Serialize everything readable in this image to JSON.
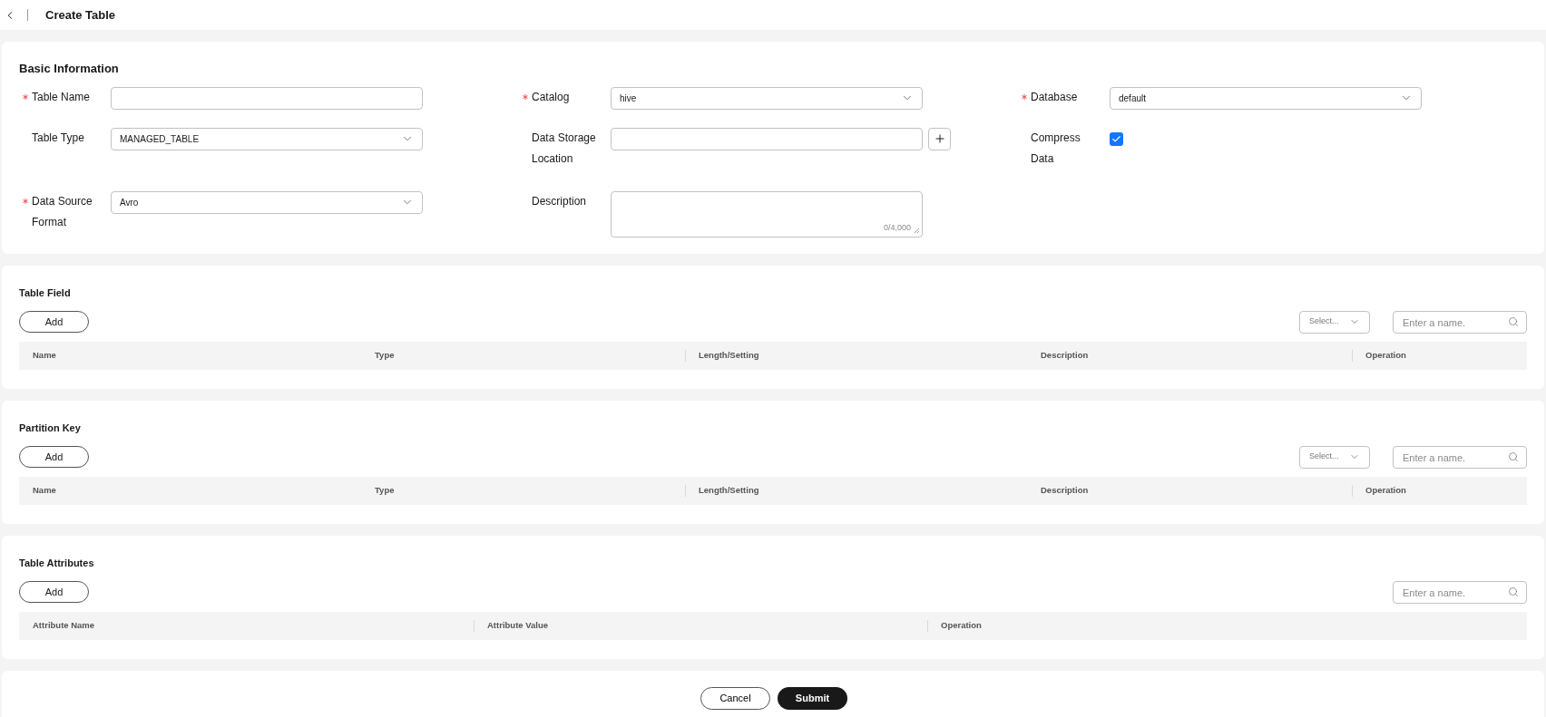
{
  "header": {
    "title": "Create Table"
  },
  "basic": {
    "title": "Basic Information",
    "fields": [
      {
        "kind": "input",
        "label": "Table Name",
        "required": true
      },
      {
        "kind": "select",
        "label": "Catalog",
        "required": true,
        "value": "hive"
      },
      {
        "kind": "select",
        "label": "Database",
        "required": true,
        "value": "default"
      },
      {
        "kind": "select",
        "label": "Table Type",
        "required": false,
        "value": "MANAGED_TABLE"
      },
      {
        "kind": "input_add",
        "label": "Data Storage Location",
        "required": false
      },
      {
        "kind": "checkbox",
        "label": "Compress Data",
        "required": false,
        "checked": true
      },
      {
        "kind": "select",
        "label": "Data Source Format",
        "required": true,
        "value": "Avro"
      },
      {
        "kind": "textarea",
        "label": "Description",
        "required": false,
        "counter": "0/4,000"
      }
    ]
  },
  "sections": [
    {
      "title": "Table Field",
      "add_button": "Add",
      "filter": {
        "placeholder": "Select..."
      },
      "search": {
        "placeholder": "Enter a name."
      },
      "columns": [
        {
          "label": "Name",
          "divider": false
        },
        {
          "label": "Type",
          "divider": false
        },
        {
          "label": "Length/Setting",
          "divider": true
        },
        {
          "label": "Description",
          "divider": false
        },
        {
          "label": "Operation",
          "divider": true
        }
      ]
    },
    {
      "title": "Partition Key",
      "add_button": "Add",
      "filter": {
        "placeholder": "Select..."
      },
      "search": {
        "placeholder": "Enter a name."
      },
      "columns": [
        {
          "label": "Name",
          "divider": false
        },
        {
          "label": "Type",
          "divider": false
        },
        {
          "label": "Length/Setting",
          "divider": true
        },
        {
          "label": "Description",
          "divider": false
        },
        {
          "label": "Operation",
          "divider": true
        }
      ]
    },
    {
      "title": "Table Attributes",
      "add_button": "Add",
      "search": {
        "placeholder": "Enter a name."
      },
      "columns": [
        {
          "label": "Attribute Name",
          "divider": false
        },
        {
          "label": "Attribute Value",
          "divider": true
        },
        {
          "label": "Operation",
          "divider": true
        }
      ]
    }
  ],
  "footer": {
    "cancel": "Cancel",
    "submit": "Submit"
  }
}
